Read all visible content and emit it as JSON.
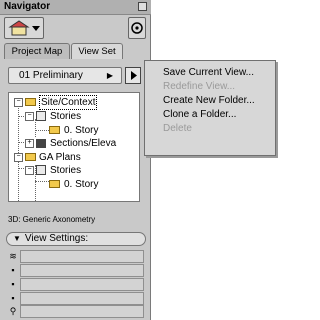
{
  "window": {
    "title": "Navigator"
  },
  "tabs": [
    {
      "label": "Project Map",
      "active": false
    },
    {
      "label": "View Set",
      "active": true
    }
  ],
  "view_set_select": {
    "value": "01 Preliminary"
  },
  "tree": [
    {
      "label": "Site/Context",
      "icon": "folder-icon",
      "selected": true
    },
    {
      "label": "Stories",
      "icon": "story-icon"
    },
    {
      "label": "0. Story",
      "icon": "folder-icon"
    },
    {
      "label": "Sections/Eleva",
      "icon": "section-icon"
    },
    {
      "label": "GA Plans",
      "icon": "folder-icon"
    },
    {
      "label": "Stories",
      "icon": "story-icon"
    },
    {
      "label": "0. Story",
      "icon": "folder-icon"
    }
  ],
  "selected_view": "3D: Generic Axonometry",
  "view_settings": {
    "label": "View Settings:"
  },
  "property_rows": [
    {
      "icon": "layers-icon"
    },
    {
      "icon": "scale-icon"
    },
    {
      "icon": "pen-icon"
    },
    {
      "icon": "model-icon"
    },
    {
      "icon": "zoom-icon"
    }
  ],
  "context_menu": {
    "items": [
      {
        "label": "Save Current View...",
        "enabled": true
      },
      {
        "label": "Redefine View...",
        "enabled": false
      },
      {
        "label": "Create New Folder...",
        "enabled": true
      },
      {
        "label": "Clone a Folder...",
        "enabled": true
      },
      {
        "label": "Delete",
        "enabled": false
      }
    ]
  }
}
